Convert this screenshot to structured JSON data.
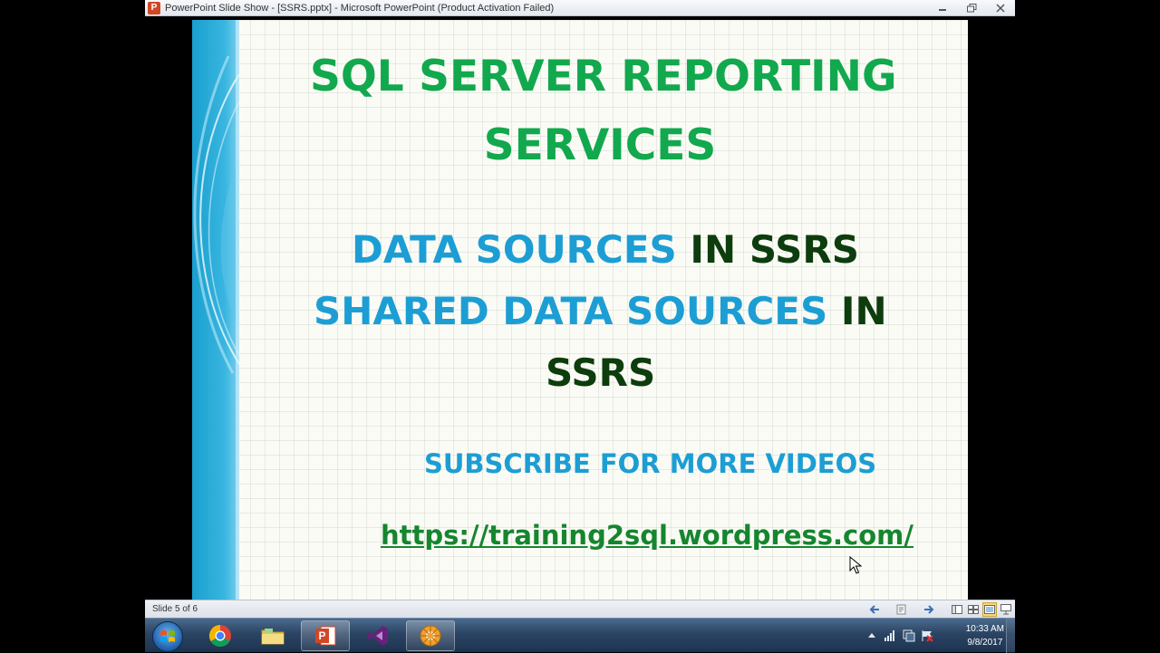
{
  "window": {
    "app_icon_letter": "P",
    "title": "PowerPoint Slide Show - [SSRS.pptx] - Microsoft PowerPoint (Product Activation Failed)",
    "controls": {
      "minimize_icon": "minimize-icon",
      "restore_icon": "restore-icon",
      "close_icon": "close-icon"
    }
  },
  "slide": {
    "title_line_1": "SQL SERVER REPORTING",
    "title_line_2": "SERVICES",
    "line_1_blue": "DATA SOURCES",
    "line_1_dark": " IN SSRS",
    "line_2_blue": "SHARED DATA SOURCES",
    "line_2_dark": " IN",
    "line_3_dark": "SSRS",
    "subscribe": "SUBSCRIBE FOR MORE VIDEOS",
    "link": "https://training2sql.wordpress.com/",
    "colors": {
      "title_green": "#12a84e",
      "blue": "#1c9ed4",
      "dark_green": "#0d3d0d",
      "link_green": "#15862e"
    }
  },
  "statusbar": {
    "slide_counter": "Slide 5 of 6",
    "prev_icon": "arrow-left-icon",
    "menu_icon": "slide-menu-icon",
    "next_icon": "arrow-right-icon",
    "views": [
      "normal-view-icon",
      "slide-sorter-icon",
      "reading-view-icon",
      "slide-show-icon"
    ]
  },
  "taskbar": {
    "start_icon": "windows-start-icon",
    "apps": [
      "chrome-icon",
      "file-explorer-icon",
      "powerpoint-icon",
      "visual-studio-icon",
      "sql-tool-icon"
    ],
    "tray_icons": [
      "tray-arrow-icon",
      "network-icon",
      "tray-display-icon",
      "tray-flag-icon"
    ],
    "clock_time": "10:33 AM",
    "clock_date": "9/8/2017"
  }
}
